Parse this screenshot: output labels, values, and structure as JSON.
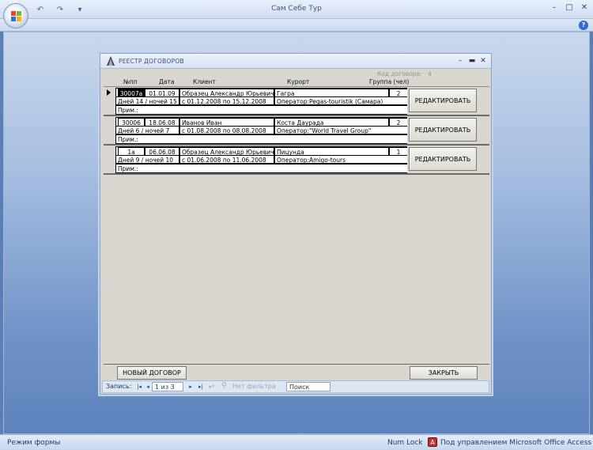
{
  "app": {
    "title": "Сам Себе Тур",
    "qat": {
      "undo": "↶",
      "redo": "↷",
      "customize": "▾"
    },
    "controls": {
      "minimize": "–",
      "maximize": "□",
      "close": "✕"
    },
    "help": "?"
  },
  "form": {
    "title": "РЕЕСТР ДОГОВОРОВ",
    "controls": {
      "minimize": "–",
      "maximize": "▬",
      "close": "✕"
    },
    "code_label": "Код договора:",
    "code_value": "4",
    "columns": {
      "num": "№пп",
      "date": "Дата",
      "client": "Клиент",
      "resort": "Курорт",
      "group": "Группа (чел)"
    },
    "records": [
      {
        "num": "30007а",
        "date": "01.01.09",
        "client": "Образец Александр Юрьевич",
        "resort": "Гагра",
        "group": "2",
        "duration": "Дней 14 / ночей 15",
        "period": "с 01.12.2008 по 15.12.2008",
        "operator": "Оператор:Pegas-touristik (Самара)",
        "note": "Прим.:",
        "edit_label": "РЕДАКТИРОВАТЬ"
      },
      {
        "num": "30006",
        "date": "18.06.08",
        "client": "Иванов Иван",
        "resort": "Коста Даурада",
        "group": "2",
        "duration": "Дней 6 / ночей 7",
        "period": "с 01.08.2008 по 08.08.2008",
        "operator": "Оператор:\"World Travel Group\"",
        "note": "Прим.:",
        "edit_label": "РЕДАКТИРОВАТЬ"
      },
      {
        "num": "1а",
        "date": "06.06.08",
        "client": "Образец Александр Юрьевич",
        "resort": "Пицунда",
        "group": "1",
        "duration": "Дней 9 / ночей 10",
        "period": "с 01.06.2008 по 11.06.2008",
        "operator": "Оператор:Amigo-tours",
        "note": "Прим.:",
        "edit_label": "РЕДАКТИРОВАТЬ"
      }
    ],
    "new_button": "НОВЫЙ ДОГОВОР",
    "close_button": "ЗАКРЫТЬ"
  },
  "navigator": {
    "label": "Запись:",
    "first": "|◂",
    "prev": "◂",
    "current": "1 из 3",
    "next": "▸",
    "last": "▸|",
    "new": "▸*",
    "filter": "Нет фильтра",
    "search": "Поиск"
  },
  "status": {
    "mode": "Режим формы",
    "numlock": "Num Lock",
    "access": "Под управлением Microsoft Office Access"
  }
}
